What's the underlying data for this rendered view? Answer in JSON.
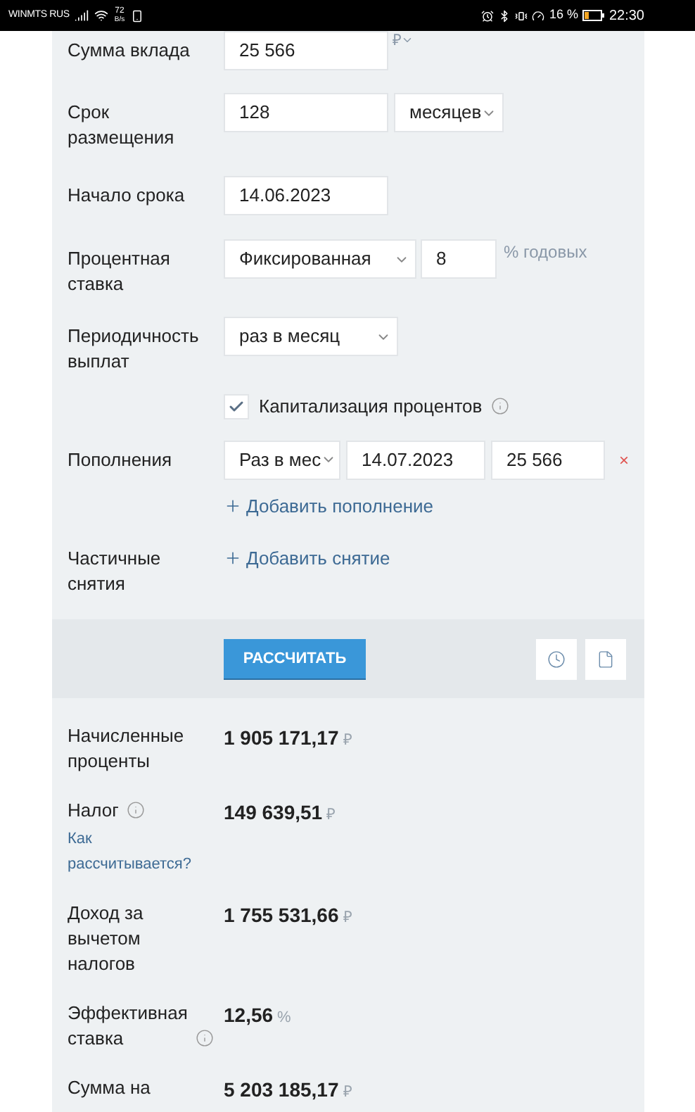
{
  "status_bar": {
    "carrier": "WINMTS RUS",
    "speed": "72",
    "speed_unit": "B/s",
    "battery": "16 %",
    "time": "22:30"
  },
  "form": {
    "deposit": {
      "label": "Сумма вклада",
      "value": "25 566",
      "currency": "₽"
    },
    "term": {
      "label": "Срок размещения",
      "value": "128",
      "unit": "месяцев"
    },
    "start": {
      "label": "Начало срока",
      "value": "14.06.2023"
    },
    "rate": {
      "label": "Процентная ставка",
      "type": "Фиксированная",
      "value": "8",
      "unit": "% годовых"
    },
    "payout": {
      "label": "Периодичность выплат",
      "value": "раз в месяц"
    },
    "capitalization": {
      "label": "Капитализация процентов",
      "checked": true
    },
    "top_ups": {
      "label": "Пополнения",
      "items": [
        {
          "frequency": "Раз в мес",
          "date": "14.07.2023",
          "amount": "25 566",
          "remove": "×"
        }
      ],
      "add_link": "Добавить пополнение"
    },
    "withdrawals": {
      "label": "Частичные снятия",
      "add_link": "Добавить снятие"
    }
  },
  "actions": {
    "calculate": "РАССЧИТАТЬ"
  },
  "results": [
    {
      "label": "Начисленные проценты",
      "info": false,
      "value": "1 905 171,17",
      "unit": "₽"
    },
    {
      "label": "Налог",
      "info": true,
      "link": "Как рассчитывается?",
      "value": "149 639,51",
      "unit": "₽"
    },
    {
      "label": "Доход за вычетом налогов",
      "info": false,
      "value": "1 755 531,66",
      "unit": "₽"
    },
    {
      "label": "Эффективная ставка",
      "info": true,
      "value": "12,56",
      "unit": "%"
    },
    {
      "label": "Сумма на",
      "info": false,
      "value": "5 203 185,17",
      "unit": "₽"
    }
  ]
}
